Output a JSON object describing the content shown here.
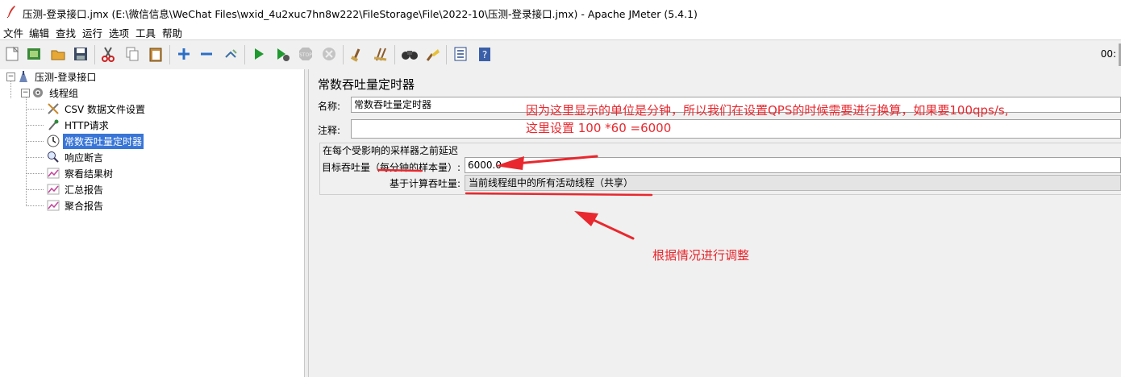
{
  "window": {
    "title": "压测-登录接口.jmx (E:\\微信信息\\WeChat Files\\wxid_4u2xuc7hn8w222\\FileStorage\\File\\2022-10\\压测-登录接口.jmx) - Apache JMeter (5.4.1)"
  },
  "menu": [
    "文件",
    "编辑",
    "查找",
    "运行",
    "选项",
    "工具",
    "帮助"
  ],
  "toolbar": {
    "clock": "00:",
    "icons": [
      "new-icon",
      "templates-icon",
      "open-icon",
      "save-icon",
      "cut-icon",
      "copy-icon",
      "paste-icon",
      "expand-icon",
      "collapse-icon",
      "toggle-icon",
      "start-icon",
      "start-no-pause-icon",
      "stop-icon",
      "shutdown-icon",
      "clear-icon",
      "clear-all-icon",
      "search-icon",
      "reset-search-icon",
      "function-helper-icon",
      "help-icon"
    ]
  },
  "tree": {
    "root": "压测-登录接口",
    "thread_group": "线程组",
    "children": [
      "CSV 数据文件设置",
      "HTTP请求",
      "常数吞吐量定时器",
      "响应断言",
      "察看结果树",
      "汇总报告",
      "聚合报告"
    ],
    "selected": "常数吞吐量定时器"
  },
  "panel": {
    "title": "常数吞吐量定时器",
    "name_label": "名称:",
    "name_value": "常数吞吐量定时器",
    "comment_label": "注释:",
    "comment_value": "",
    "group_title": "在每个受影响的采样器之前延迟",
    "target_label_prefix": "目标吞吐量（",
    "target_label_highlight": "每分钟的样本量",
    "target_label_suffix": "）:",
    "target_value": "6000.0",
    "based_on_label": "基于计算吞吐量:",
    "based_on_value": "当前线程组中的所有活动线程（共享）"
  },
  "annotations": {
    "line1": "因为这里显示的单位是分钟，所以我们在设置QPS的时候需要进行换算，如果要100qps/s,",
    "line2": "这里设置 100 *60 =6000",
    "line3": "根据情况进行调整",
    "color": "#e8282e"
  }
}
